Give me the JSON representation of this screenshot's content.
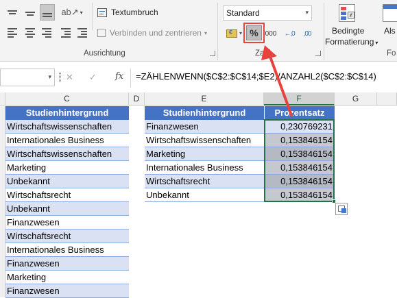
{
  "ribbon": {
    "wrap_text": "Textumbruch",
    "merge_center": "Verbinden und zentrieren",
    "group_alignment": "Ausrichtung",
    "number_format": "Standard",
    "percent_symbol": "%",
    "thousands_label": "000",
    "decimal_inc": "←,0",
    "decimal_dec": ",00",
    "group_number": "Zahl",
    "cond_format_line1": "Bedingte",
    "cond_format_line2": "Formatierung",
    "format_as_label": "Als",
    "group_formats": "Fo"
  },
  "formula_bar": {
    "cancel": "✕",
    "enter": "✓",
    "fx": "fx",
    "formula": "=ZÄHLENWENN($C$2:$C$14;$E2)/ANZAHL2($C$2:$C$14)"
  },
  "columns": {
    "c": "C",
    "d": "D",
    "e": "E",
    "f": "F",
    "g": "G"
  },
  "source_table": {
    "header": "Studienhintergrund",
    "rows": [
      "Wirtschaftswissenschaften",
      "Internationales Business",
      "Wirtschaftswissenschaften",
      "Marketing",
      "Unbekannt",
      "Wirtschaftsrecht",
      "Unbekannt",
      "Finanzwesen",
      "Wirtschaftsrecht",
      "Internationales Business",
      "Finanzwesen",
      "Marketing",
      "Finanzwesen"
    ]
  },
  "summary_table": {
    "header_category": "Studienhintergrund",
    "header_percent": "Prozentsatz",
    "rows": [
      {
        "category": "Finanzwesen",
        "value": "0,230769231"
      },
      {
        "category": "Wirtschaftswissenschaften",
        "value": "0,153846154"
      },
      {
        "category": "Marketing",
        "value": "0,153846154"
      },
      {
        "category": "Internationales Business",
        "value": "0,153846154"
      },
      {
        "category": "Wirtschaftsrecht",
        "value": "0,153846154"
      },
      {
        "category": "Unbekannt",
        "value": "0,153846154"
      }
    ]
  },
  "colors": {
    "header_blue": "#4472c4",
    "band_blue": "#d9e1f2",
    "excel_green": "#217346",
    "arrow_red": "#e8423f"
  }
}
